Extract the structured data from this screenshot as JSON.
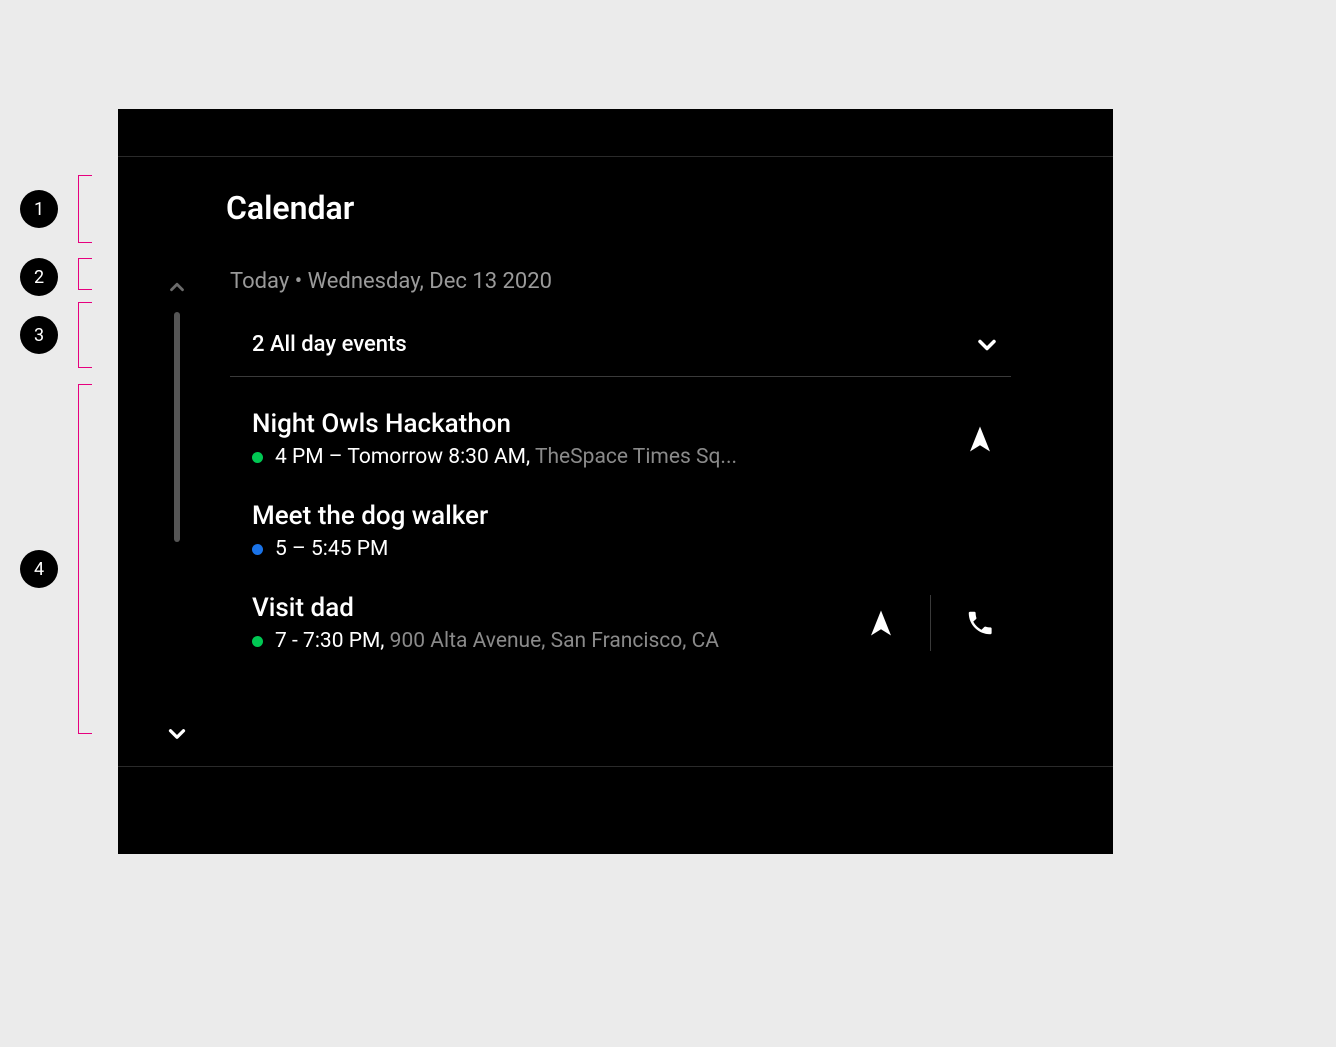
{
  "annotations": [
    "1",
    "2",
    "3",
    "4"
  ],
  "header": {
    "title": "Calendar"
  },
  "subtitle": {
    "text": "Today • Wednesday, Dec 13 2020"
  },
  "allday": {
    "label": "2 All day events"
  },
  "events": [
    {
      "title": "Night Owls Hackathon",
      "time": "4 PM – Tomorrow 8:30 AM,",
      "location": "TheSpace Times Sq...",
      "color": "green",
      "nav": true,
      "call": false
    },
    {
      "title": "Meet the dog walker",
      "time": "5 – 5:45 PM",
      "location": "",
      "color": "blue",
      "nav": false,
      "call": false
    },
    {
      "title": "Visit dad",
      "time": "7 - 7:30 PM,",
      "location": "900 Alta Avenue, San Francisco, CA",
      "color": "green",
      "nav": true,
      "call": true
    }
  ]
}
